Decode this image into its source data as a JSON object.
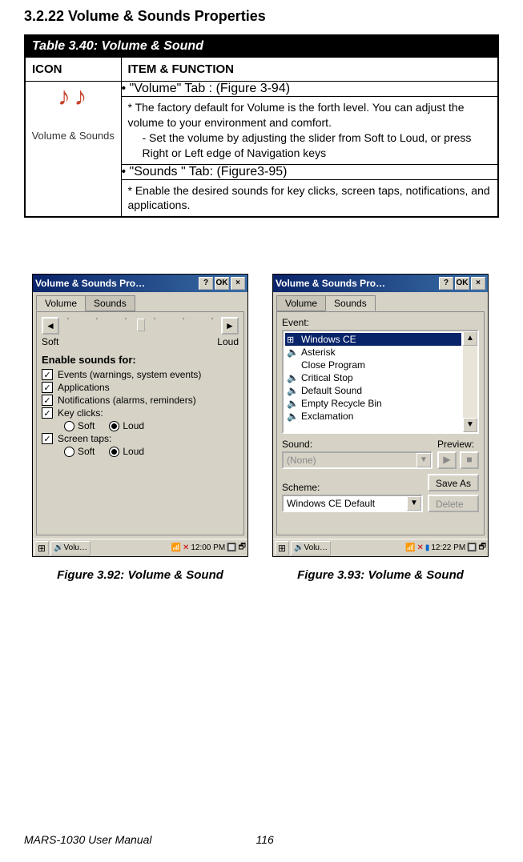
{
  "section_heading": "3.2.22   Volume & Sounds Properties",
  "table": {
    "title": "Table 3.40: Volume & Sound",
    "col_icon": "ICON",
    "col_item": "ITEM & FUNCTION",
    "icon_label": "Volume & Sounds",
    "tab1": "•  \"Volume\" Tab : (Figure 3-94)",
    "desc1": "*  The factory default for Volume is the forth level. You can adjust the volume to your environment and comfort.",
    "desc1sub": "-  Set the volume by adjusting the slider from Soft to Loud, or press Right or Left edge of Navigation keys",
    "tab2": "•  \"Sounds \" Tab: (Figure3-95)",
    "desc2": "*  Enable the desired sounds for key clicks, screen taps, notifications, and applications."
  },
  "fig1": {
    "title": "Volume & Sounds Pro…",
    "ok": "OK",
    "tab_volume": "Volume",
    "tab_sounds": "Sounds",
    "soft": "Soft",
    "loud": "Loud",
    "enable_label": "Enable sounds for:",
    "chk_events": "Events (warnings, system events)",
    "chk_apps": "Applications",
    "chk_notif": "Notifications (alarms, reminders)",
    "chk_key": "Key clicks:",
    "chk_screen": "Screen taps:",
    "radio_soft": "Soft",
    "radio_loud": "Loud",
    "task_app": "Volu…",
    "task_time": "12:00 PM",
    "caption": "Figure 3.92: Volume & Sound"
  },
  "fig2": {
    "title": "Volume & Sounds Pro…",
    "ok": "OK",
    "tab_volume": "Volume",
    "tab_sounds": "Sounds",
    "event_label": "Event:",
    "items": {
      "windows_ce": "Windows CE",
      "asterisk": "Asterisk",
      "close_program": "Close Program",
      "critical_stop": "Critical Stop",
      "default_sound": "Default Sound",
      "empty_recycle": "Empty Recycle Bin",
      "exclamation": "Exclamation"
    },
    "sound_label": "Sound:",
    "preview_label": "Preview:",
    "sound_value": "(None)",
    "scheme_label": "Scheme:",
    "scheme_value": "Windows CE Default",
    "save_as": "Save As",
    "delete": "Delete",
    "task_app": "Volu…",
    "task_time": "12:22 PM",
    "caption": "Figure 3.93: Volume & Sound"
  },
  "footer": {
    "manual": "MARS-1030 User Manual",
    "page": "116"
  }
}
